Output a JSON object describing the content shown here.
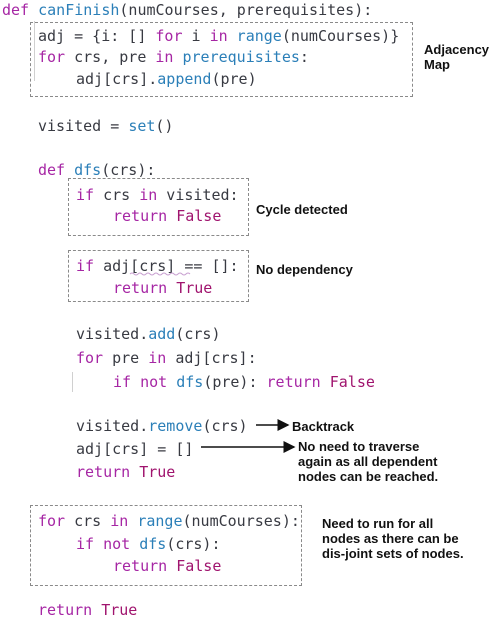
{
  "code": {
    "l1": {
      "kw": "def",
      "name": "canFinish",
      "args": "(numCourses, prerequisites):"
    },
    "l2": {
      "a": "adj = {i: [] ",
      "kw1": "for",
      "b": " i ",
      "kw2": "in",
      "fn": " range",
      "c": "(numCourses)}"
    },
    "l3": {
      "kw1": "for",
      "a": " crs, pre ",
      "kw2": "in",
      "fn": " prerequisites",
      "b": ":"
    },
    "l4": {
      "a": "adj[crs].",
      "fn": "append",
      "b": "(pre)"
    },
    "l5": {
      "a": "visited = ",
      "fn": "set",
      "b": "()"
    },
    "l6": {
      "kw": "def",
      "name": " dfs",
      "args": "(crs):"
    },
    "l7": {
      "kw1": "if",
      "a": " crs ",
      "kw2": "in",
      "b": " visited:"
    },
    "l8": {
      "kw": "return",
      "val": " False"
    },
    "l9": {
      "kw": "if",
      "a": " adj[crs] == []:"
    },
    "l10": {
      "kw": "return",
      "val": " True"
    },
    "l11": {
      "a": "visited.",
      "fn": "add",
      "b": "(crs)"
    },
    "l12": {
      "kw1": "for",
      "a": " pre ",
      "kw2": "in",
      "b": " adj[crs]:"
    },
    "l13": {
      "kw1": "if",
      "kw2": " not",
      "fn": " dfs",
      "a": "(pre): ",
      "kw3": "return",
      "val": " False"
    },
    "l14": {
      "a": "visited.",
      "fn": "remove",
      "b": "(crs)"
    },
    "l15": {
      "a": "adj[crs] = []"
    },
    "l16": {
      "kw": "return",
      "val": " True"
    },
    "l17": {
      "kw1": "for",
      "a": " crs ",
      "kw2": "in",
      "fn": " range",
      "b": "(numCourses):"
    },
    "l18": {
      "kw1": "if",
      "kw2": " not",
      "fn": " dfs",
      "a": "(crs):"
    },
    "l19": {
      "kw": "return",
      "val": " False"
    },
    "l20": {
      "kw": "return",
      "val": " True"
    }
  },
  "annotations": {
    "adjacency_map": "Adjacency\nMap",
    "cycle_detected": "Cycle detected",
    "no_dependency": "No dependency",
    "backtrack": "Backtrack",
    "no_need": "No need to traverse\nagain as all dependent\nnodes can be reached.",
    "need_to_run": "Need to run for all\nnodes as there can be\ndis-joint sets of nodes."
  }
}
